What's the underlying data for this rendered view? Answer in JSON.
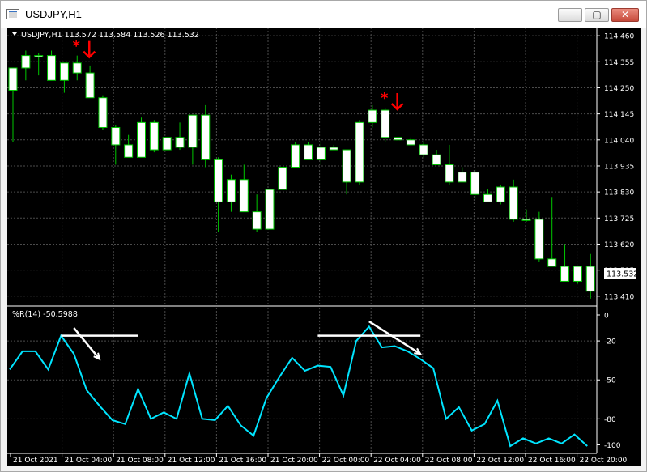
{
  "window": {
    "title": "USDJPY,H1",
    "minimize_glyph": "—",
    "maximize_glyph": "▢",
    "close_glyph": "✕"
  },
  "price_panel": {
    "header": "USDJPY,H1  113.572 113.584 113.526 113.532",
    "current_price_label": "113.532",
    "marker_colors": {
      "asterisk": "#ff0000",
      "arrow": "#ff0000"
    }
  },
  "indicator_panel": {
    "header": "%R(14) -50.5988",
    "line_color": "#00e5ff",
    "trendline_color": "#ffffff"
  },
  "colors": {
    "background": "#000000",
    "grid": "#4b4b4b",
    "candle_body": "#ffffff",
    "wick": "#00c800"
  },
  "chart_data": [
    {
      "type": "candlestick",
      "title": "USDJPY,H1",
      "ylim": [
        113.38,
        114.48
      ],
      "y_ticks": [
        "114.460",
        "114.355",
        "114.250",
        "114.145",
        "114.040",
        "113.935",
        "113.830",
        "113.725",
        "113.620",
        "113.515",
        "113.410"
      ],
      "x_ticks": [
        "21 Oct 2021",
        "21 Oct 04:00",
        "21 Oct 08:00",
        "21 Oct 12:00",
        "21 Oct 16:00",
        "21 Oct 20:00",
        "22 Oct 00:00",
        "22 Oct 04:00",
        "22 Oct 08:00",
        "22 Oct 12:00",
        "22 Oct 16:00",
        "22 Oct 20:00"
      ],
      "candles": [
        [
          114.24,
          114.33,
          114.03,
          114.33
        ],
        [
          114.33,
          114.4,
          114.28,
          114.38
        ],
        [
          114.38,
          114.39,
          114.3,
          114.38
        ],
        [
          114.38,
          114.4,
          114.29,
          114.28
        ],
        [
          114.28,
          114.33,
          114.23,
          114.35
        ],
        [
          114.35,
          114.38,
          114.28,
          114.31
        ],
        [
          114.31,
          114.34,
          114.22,
          114.21
        ],
        [
          114.21,
          114.22,
          114.08,
          114.09
        ],
        [
          114.09,
          114.1,
          113.94,
          114.02
        ],
        [
          114.02,
          114.06,
          113.97,
          113.97
        ],
        [
          113.97,
          114.13,
          113.97,
          114.11
        ],
        [
          114.11,
          114.12,
          113.99,
          114.0
        ],
        [
          114.0,
          114.05,
          114.0,
          114.05
        ],
        [
          114.05,
          114.11,
          114.0,
          114.01
        ],
        [
          114.01,
          114.14,
          113.94,
          114.14
        ],
        [
          114.14,
          114.18,
          113.93,
          113.96
        ],
        [
          113.96,
          113.97,
          113.67,
          113.79
        ],
        [
          113.79,
          113.9,
          113.75,
          113.88
        ],
        [
          113.88,
          113.94,
          113.75,
          113.75
        ],
        [
          113.75,
          113.82,
          113.67,
          113.68
        ],
        [
          113.68,
          113.84,
          113.68,
          113.84
        ],
        [
          113.84,
          113.93,
          113.84,
          113.93
        ],
        [
          113.93,
          114.03,
          113.93,
          114.02
        ],
        [
          114.02,
          114.03,
          113.96,
          113.96
        ],
        [
          113.96,
          114.03,
          113.94,
          114.01
        ],
        [
          114.01,
          114.02,
          114.0,
          114.0
        ],
        [
          114.0,
          114.0,
          113.82,
          113.87
        ],
        [
          113.87,
          114.12,
          113.86,
          114.11
        ],
        [
          114.11,
          114.18,
          114.09,
          114.16
        ],
        [
          114.16,
          114.17,
          114.03,
          114.05
        ],
        [
          114.05,
          114.06,
          114.04,
          114.04
        ],
        [
          114.04,
          114.05,
          114.02,
          114.02
        ],
        [
          114.02,
          114.03,
          113.97,
          113.98
        ],
        [
          113.98,
          114.0,
          113.95,
          113.94
        ],
        [
          113.94,
          114.02,
          113.86,
          113.87
        ],
        [
          113.87,
          113.93,
          113.87,
          113.91
        ],
        [
          113.91,
          113.92,
          113.8,
          113.82
        ],
        [
          113.82,
          113.84,
          113.79,
          113.79
        ],
        [
          113.79,
          113.86,
          113.78,
          113.85
        ],
        [
          113.85,
          113.88,
          113.71,
          113.72
        ],
        [
          113.72,
          113.76,
          113.71,
          113.72
        ],
        [
          113.72,
          113.75,
          113.55,
          113.56
        ],
        [
          113.56,
          113.81,
          113.53,
          113.53
        ],
        [
          113.53,
          113.62,
          113.47,
          113.47
        ],
        [
          113.47,
          113.53,
          113.46,
          113.53
        ],
        [
          113.53,
          113.58,
          113.4,
          113.43
        ]
      ],
      "annotations": [
        {
          "type": "sell-marker",
          "candle_index": 5,
          "price": 114.31
        },
        {
          "type": "sell-marker",
          "candle_index": 29,
          "price": 114.16
        }
      ]
    },
    {
      "type": "line",
      "title": "%R(14) -50.5988",
      "ylim": [
        0,
        -100
      ],
      "y_ticks": [
        "0",
        "-20",
        "-50",
        "-80",
        "-100"
      ],
      "series": [
        {
          "values": [
            -42,
            -28,
            -28,
            -42,
            -16,
            -30,
            -58,
            -70,
            -81,
            -84,
            -57,
            -80,
            -75,
            -80,
            -45,
            -80,
            -81,
            -70,
            -85,
            -93,
            -64,
            -48,
            -33,
            -43,
            -39,
            -40,
            -62,
            -20,
            -9,
            -25,
            -24,
            -28,
            -34,
            -41,
            -80,
            -71,
            -89,
            -84,
            -66,
            -101,
            -95,
            -99,
            -95,
            -99,
            -92,
            -102
          ]
        }
      ],
      "trendlines": [
        {
          "from": [
            4,
            -16
          ],
          "to": [
            10,
            -16
          ]
        },
        {
          "from": [
            5,
            -10
          ],
          "to": [
            7,
            -34
          ]
        },
        {
          "from": [
            24,
            -16
          ],
          "to": [
            32,
            -16
          ]
        },
        {
          "from": [
            28,
            -5
          ],
          "to": [
            32,
            -30
          ]
        }
      ]
    }
  ]
}
